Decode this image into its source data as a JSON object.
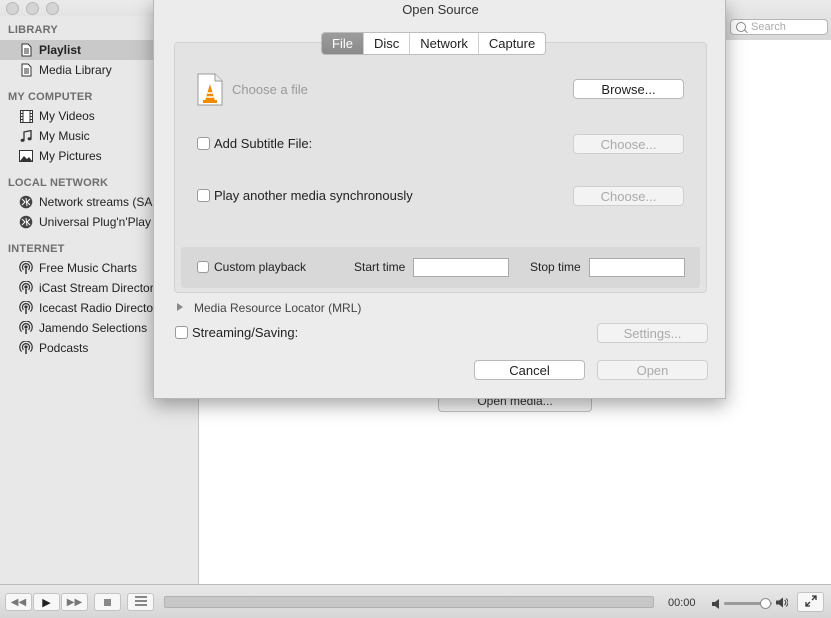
{
  "window": {
    "search_placeholder": "Search"
  },
  "sidebar": {
    "sections": [
      {
        "title": "LIBRARY",
        "items": [
          {
            "label": "Playlist",
            "icon": "playlist-icon",
            "selected": true
          },
          {
            "label": "Media Library",
            "icon": "media-library-icon"
          }
        ]
      },
      {
        "title": "MY COMPUTER",
        "items": [
          {
            "label": "My Videos",
            "icon": "film-icon"
          },
          {
            "label": "My Music",
            "icon": "music-note-icon"
          },
          {
            "label": "My Pictures",
            "icon": "picture-icon"
          }
        ]
      },
      {
        "title": "LOCAL NETWORK",
        "items": [
          {
            "label": "Network streams (SAP)",
            "icon": "network-icon"
          },
          {
            "label": "Universal Plug'n'Play",
            "icon": "network-icon"
          }
        ]
      },
      {
        "title": "INTERNET",
        "items": [
          {
            "label": "Free Music Charts",
            "icon": "podcast-icon"
          },
          {
            "label": "iCast Stream Directory",
            "icon": "podcast-icon"
          },
          {
            "label": "Icecast Radio Directory",
            "icon": "podcast-icon"
          },
          {
            "label": "Jamendo Selections",
            "icon": "podcast-icon"
          },
          {
            "label": "Podcasts",
            "icon": "podcast-icon"
          }
        ]
      }
    ]
  },
  "content": {
    "open_media_label": "Open media..."
  },
  "dialog": {
    "title": "Open Source",
    "tabs": [
      {
        "label": "File",
        "active": true
      },
      {
        "label": "Disc"
      },
      {
        "label": "Network"
      },
      {
        "label": "Capture"
      }
    ],
    "file": {
      "choose_label": "Choose a file",
      "browse_label": "Browse..."
    },
    "subtitle": {
      "label": "Add Subtitle File:",
      "choose_label": "Choose..."
    },
    "sync": {
      "label": "Play another media synchronously",
      "choose_label": "Choose..."
    },
    "playback": {
      "custom_label": "Custom playback",
      "start_label": "Start time",
      "stop_label": "Stop time",
      "start_value": "",
      "stop_value": ""
    },
    "mrl_label": "Media Resource Locator (MRL)",
    "streaming": {
      "label": "Streaming/Saving:",
      "settings_label": "Settings..."
    },
    "cancel_label": "Cancel",
    "open_label": "Open"
  },
  "controlbar": {
    "time": "00:00",
    "volume_fraction": 0.85
  },
  "colors": {
    "active_tab": "#919191",
    "selected_row": "#c9c9c9",
    "vlc_orange": "#f08a00"
  }
}
